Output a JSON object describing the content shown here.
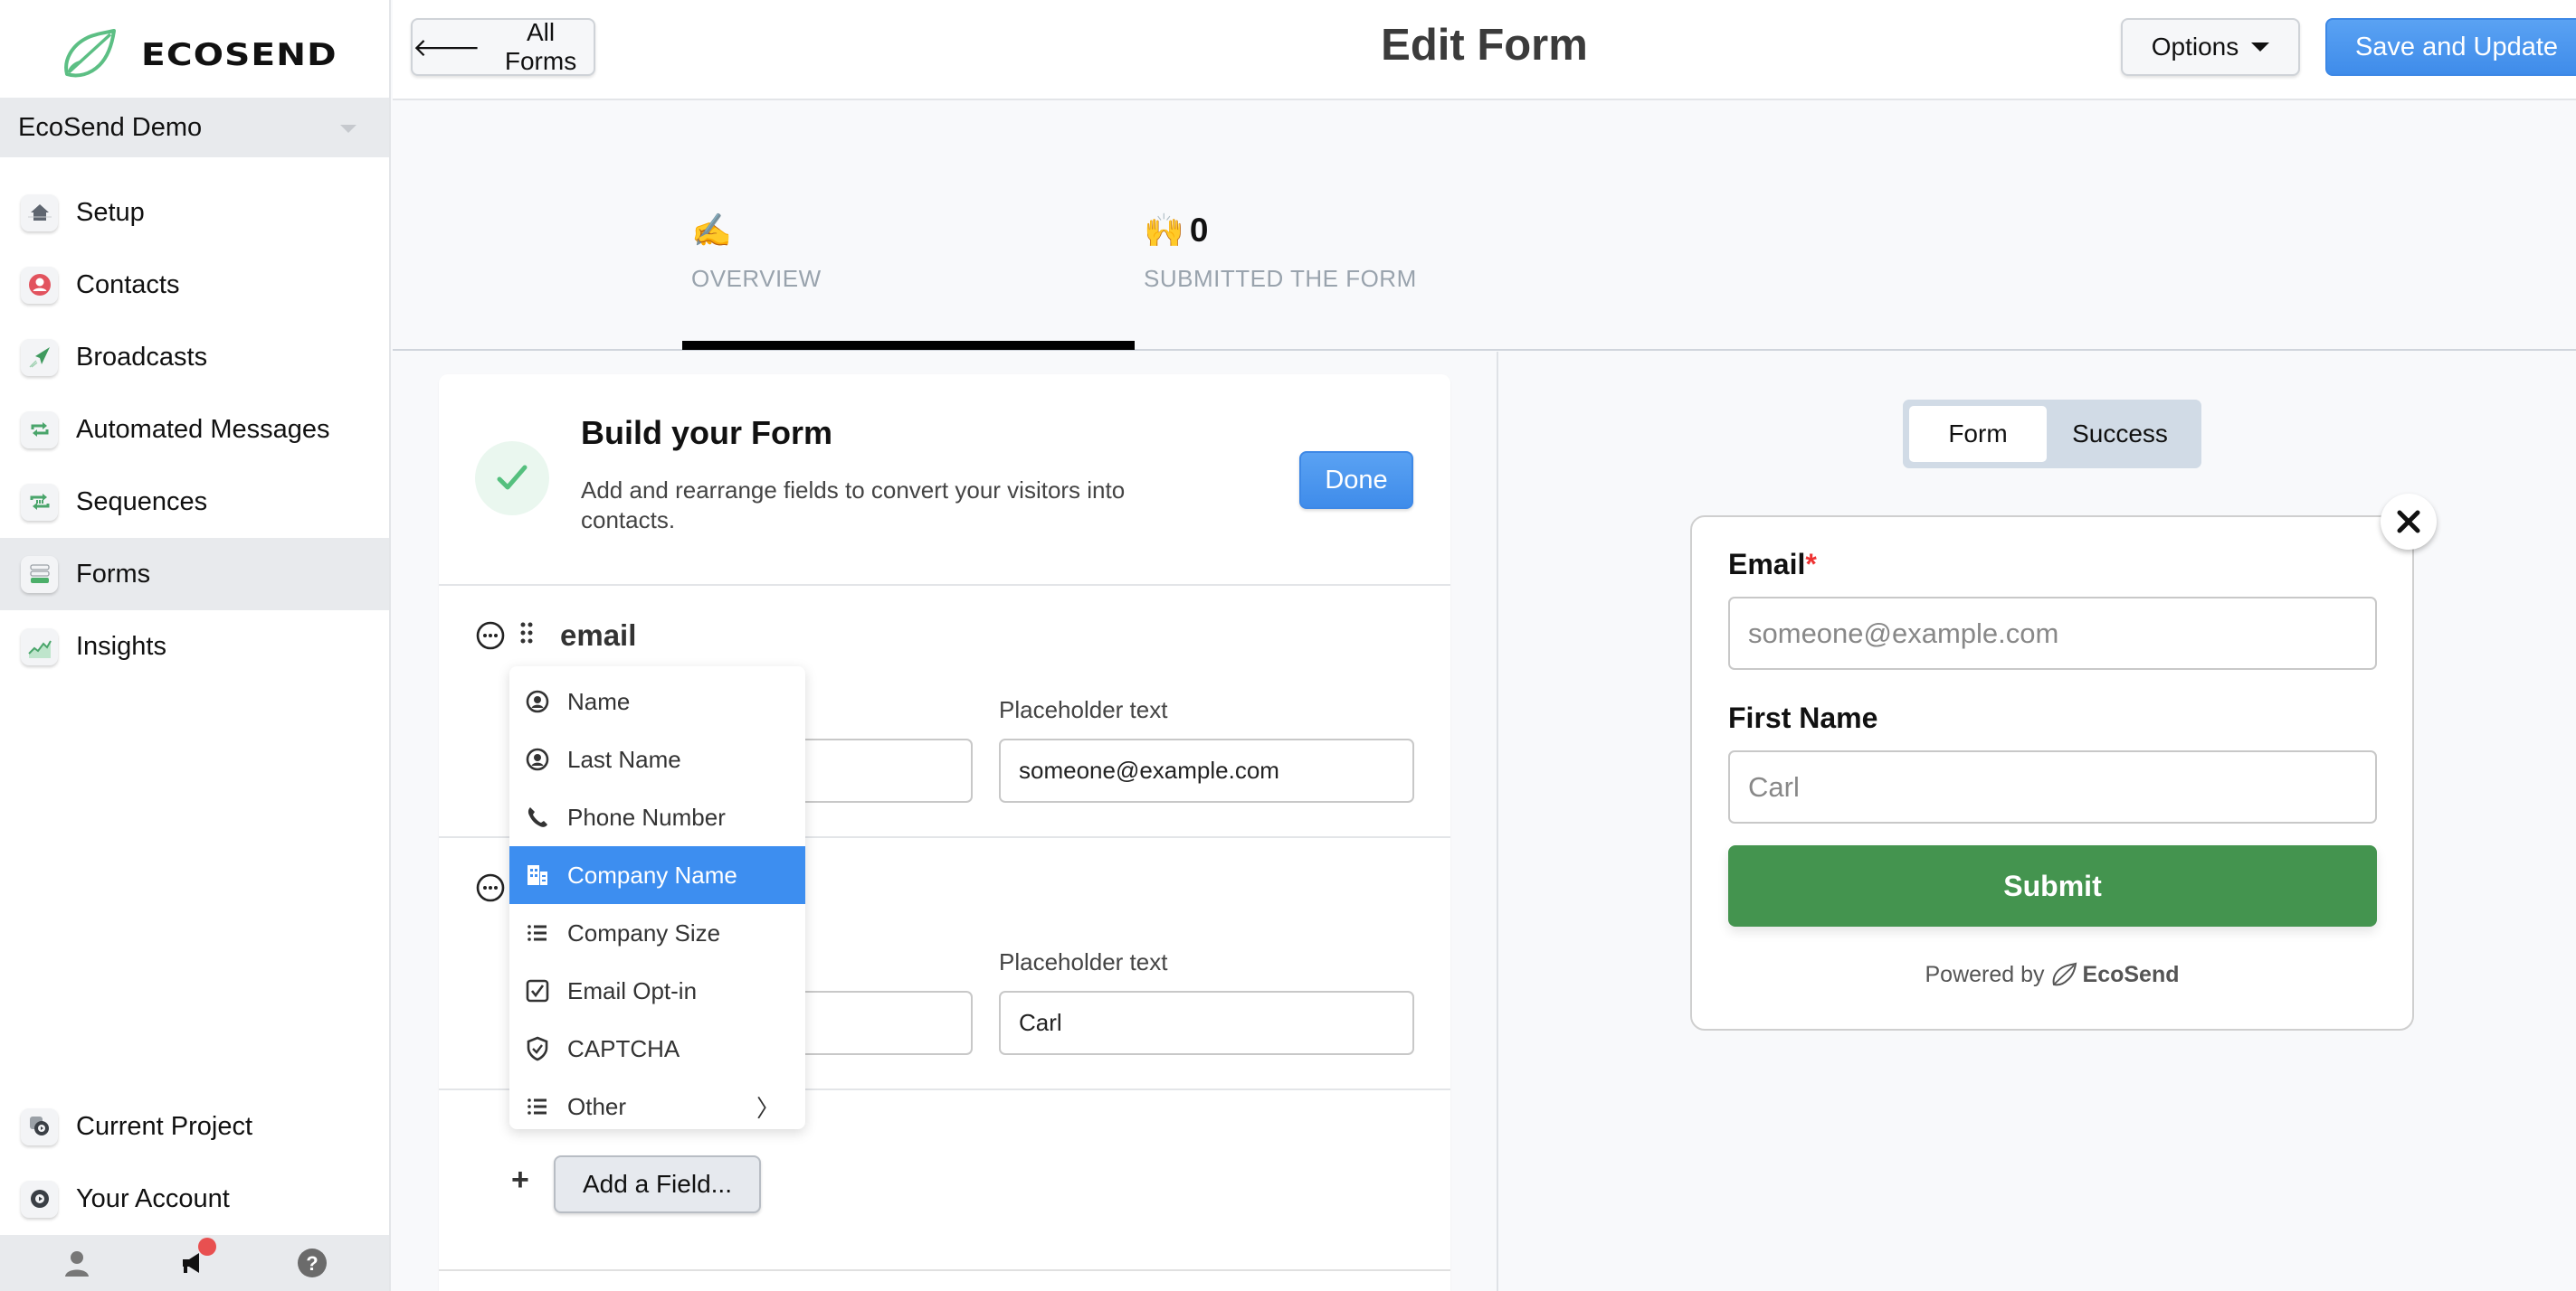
{
  "brand": {
    "name": "ECOSEND",
    "logo_icon": "leaf-icon",
    "accent_color": "#5cbf84"
  },
  "sidebar": {
    "project": "EcoSend Demo",
    "items": [
      {
        "label": "Setup",
        "icon": "home-icon",
        "active": false
      },
      {
        "label": "Contacts",
        "icon": "contact-icon",
        "active": false
      },
      {
        "label": "Broadcasts",
        "icon": "paper-plane-icon",
        "active": false
      },
      {
        "label": "Automated Messages",
        "icon": "repeat-icon",
        "active": false
      },
      {
        "label": "Sequences",
        "icon": "sequence-icon",
        "active": false
      },
      {
        "label": "Forms",
        "icon": "form-icon",
        "active": true
      },
      {
        "label": "Insights",
        "icon": "chart-icon",
        "active": false
      }
    ],
    "bottom_items": [
      {
        "label": "Current Project",
        "icon": "project-settings-icon"
      },
      {
        "label": "Your Account",
        "icon": "account-settings-icon"
      }
    ],
    "footer_icons": [
      "user-icon",
      "megaphone-icon",
      "help-icon"
    ]
  },
  "header": {
    "back_label": "All Forms",
    "title": "Edit Form",
    "options_label": "Options",
    "save_label": "Save and Update",
    "primary_color": "#4a95ef"
  },
  "tabs": [
    {
      "emoji": "✍️",
      "count": "",
      "label": "OVERVIEW",
      "active": true
    },
    {
      "emoji": "🙌",
      "count": "0",
      "label": "SUBMITTED THE FORM",
      "active": false
    }
  ],
  "builder": {
    "title": "Build your Form",
    "description": "Add and rearrange fields to convert your visitors into contacts.",
    "done_label": "Done",
    "fields": [
      {
        "name": "email",
        "placeholder_label": "Placeholder text",
        "placeholder_value": "someone@example.com"
      },
      {
        "name": "",
        "placeholder_label": "Placeholder text",
        "placeholder_value": "Carl"
      }
    ],
    "add_field_label": "Add a Field..."
  },
  "field_dropdown": {
    "items": [
      {
        "label": "Name",
        "icon": "user-circle-icon",
        "selected": false
      },
      {
        "label": "Last Name",
        "icon": "user-circle-icon",
        "selected": false
      },
      {
        "label": "Phone Number",
        "icon": "phone-icon",
        "selected": false
      },
      {
        "label": "Company Name",
        "icon": "building-icon",
        "selected": true
      },
      {
        "label": "Company Size",
        "icon": "list-icon",
        "selected": false
      },
      {
        "label": "Email Opt-in",
        "icon": "checkbox-icon",
        "selected": false
      },
      {
        "label": "CAPTCHA",
        "icon": "shield-check-icon",
        "selected": false
      },
      {
        "label": "Other",
        "icon": "list-icon",
        "selected": false,
        "submenu": true
      }
    ],
    "submenu_chevron": "〉",
    "highlight_color": "#3d8ef0"
  },
  "preview": {
    "toggle": {
      "options": [
        "Form",
        "Success"
      ],
      "active": "Form"
    },
    "fields": [
      {
        "label": "Email",
        "required": true,
        "required_mark": "*",
        "placeholder": "someone@example.com"
      },
      {
        "label": "First Name",
        "required": false,
        "placeholder": "Carl"
      }
    ],
    "submit_label": "Submit",
    "submit_color": "#44944f",
    "powered_by": "Powered by",
    "powered_brand": "EcoSend"
  }
}
